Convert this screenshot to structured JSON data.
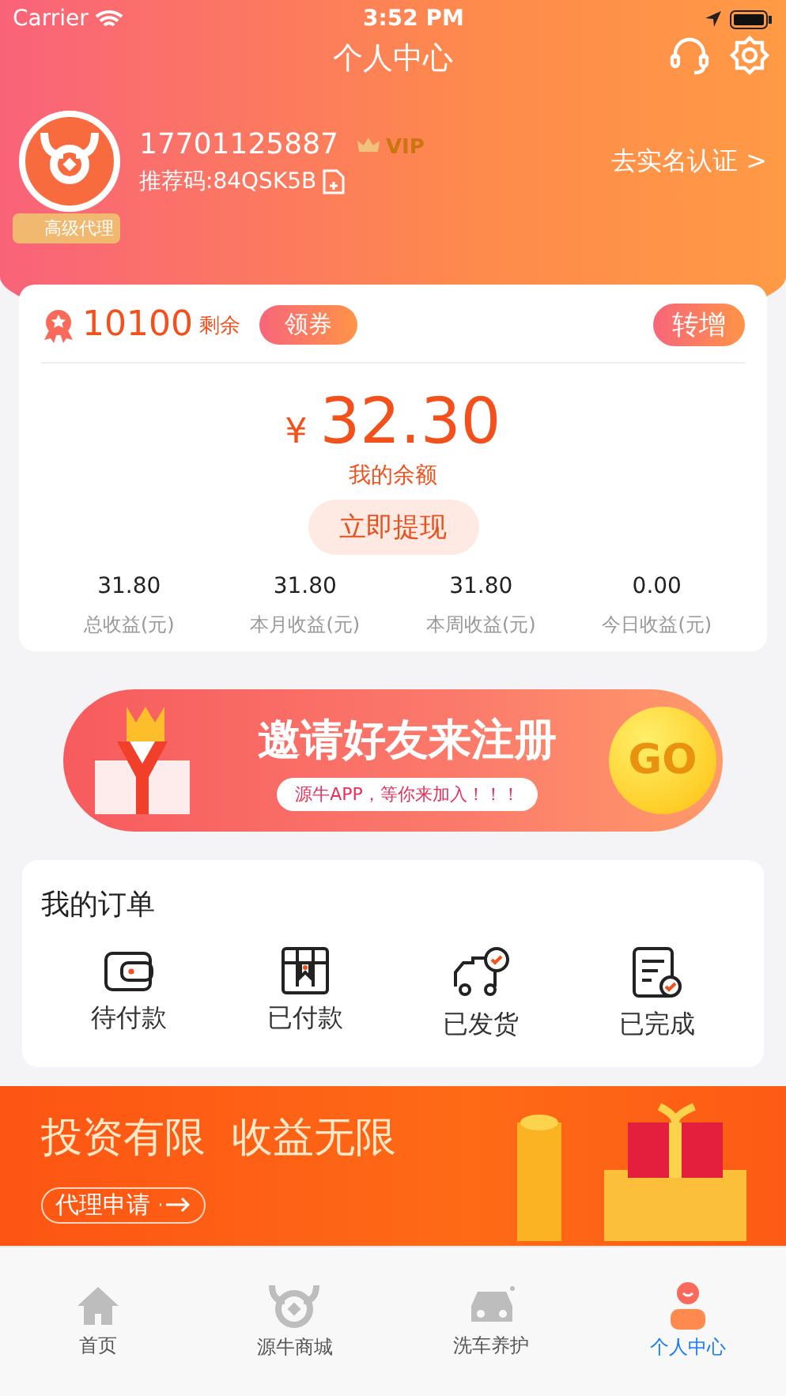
{
  "status_bar": {
    "carrier": "Carrier",
    "time": "3:52 PM"
  },
  "nav": {
    "title": "个人中心"
  },
  "profile": {
    "phone": "17701125887",
    "vip": "VIP",
    "referral": "推荐码:84QSK5B",
    "badge": "高级代理",
    "verify_link": "去实名认证 >"
  },
  "wallet": {
    "points": "10100",
    "points_suffix": "剩余",
    "coupon_button": "领券",
    "transfer_button": "转增",
    "currency": "¥",
    "balance": "32.30",
    "balance_label": "我的余额",
    "withdraw_button": "立即提现",
    "stats": [
      {
        "value": "31.80",
        "label": "总收益(元)"
      },
      {
        "value": "31.80",
        "label": "本月收益(元)"
      },
      {
        "value": "31.80",
        "label": "本周收益(元)"
      },
      {
        "value": "0.00",
        "label": "今日收益(元)"
      }
    ]
  },
  "invite_banner": {
    "headline": "邀请好友来注册",
    "subline": "源牛APP，等你来加入！！！",
    "go": "GO"
  },
  "orders": {
    "title": "我的订单",
    "items": [
      {
        "kind": "wallet",
        "label": "待付款"
      },
      {
        "kind": "box",
        "label": "已付款"
      },
      {
        "kind": "truck",
        "label": "已发货"
      },
      {
        "kind": "document",
        "label": "已完成"
      }
    ]
  },
  "agent_banner": {
    "headline": "投资有限  收益无限",
    "button": "代理申请"
  },
  "tab_bar": [
    {
      "kind": "home",
      "label": "首页",
      "selected": false
    },
    {
      "kind": "bull",
      "label": "源牛商城",
      "selected": false
    },
    {
      "kind": "car",
      "label": "洗车养护",
      "selected": false
    },
    {
      "kind": "person",
      "label": "个人中心",
      "selected": true
    }
  ]
}
